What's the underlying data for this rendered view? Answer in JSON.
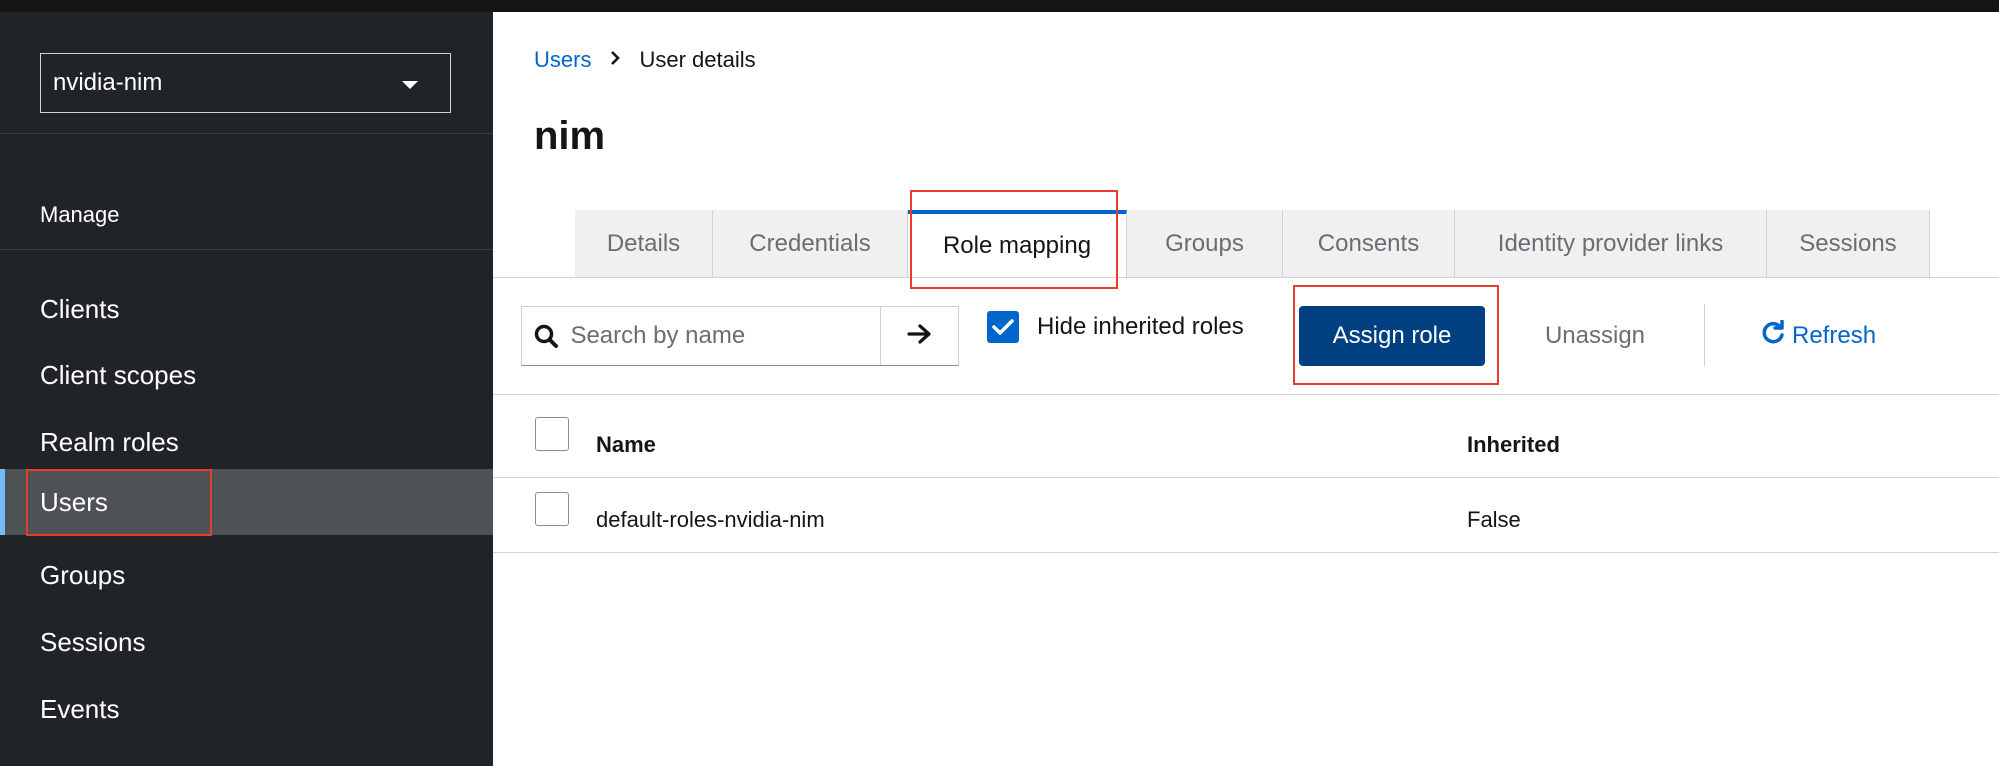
{
  "sidebar": {
    "realm": "nvidia-nim",
    "section_title": "Manage",
    "items": [
      {
        "label": "Clients"
      },
      {
        "label": "Client scopes"
      },
      {
        "label": "Realm roles"
      },
      {
        "label": "Users"
      },
      {
        "label": "Groups"
      },
      {
        "label": "Sessions"
      },
      {
        "label": "Events"
      }
    ],
    "active_item": "Users"
  },
  "breadcrumb": {
    "root": "Users",
    "separator": "›",
    "current": "User details"
  },
  "page": {
    "title": "nim"
  },
  "tabs": [
    {
      "label": "Details"
    },
    {
      "label": "Credentials"
    },
    {
      "label": "Role mapping"
    },
    {
      "label": "Groups"
    },
    {
      "label": "Consents"
    },
    {
      "label": "Identity provider links"
    },
    {
      "label": "Sessions"
    }
  ],
  "active_tab": "Role mapping",
  "toolbar": {
    "search_placeholder": "Search by name",
    "search_value": "",
    "hide_inherited_label": "Hide inherited roles",
    "hide_inherited_checked": true,
    "assign_label": "Assign role",
    "unassign_label": "Unassign",
    "refresh_label": "Refresh"
  },
  "table": {
    "columns": [
      "Name",
      "Inherited"
    ],
    "rows": [
      {
        "name": "default-roles-nvidia-nim",
        "inherited": "False"
      }
    ]
  },
  "colors": {
    "primary": "#0066cc",
    "primary_dark": "#004080",
    "sidebar_bg": "#212427",
    "sidebar_active": "#4f5255",
    "active_indicator": "#73bcf7",
    "highlight": "#e53e2e"
  },
  "icons": {
    "search": "search-icon",
    "go": "arrow-right-icon",
    "refresh": "refresh-icon",
    "realm_dropdown": "caret-down-icon",
    "breadcrumb_separator": "chevron-right-icon"
  }
}
